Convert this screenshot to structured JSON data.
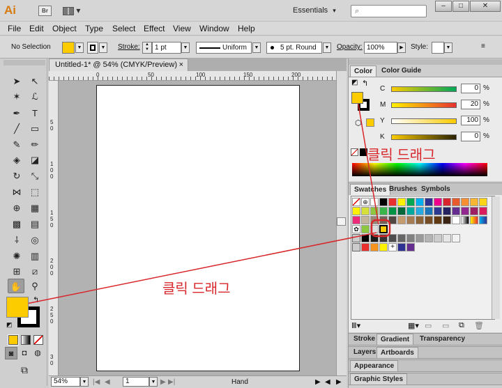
{
  "app": {
    "logo": "Ai",
    "bridge": "Br",
    "layout_arrow": "▾",
    "workspace": "Essentials",
    "workspace_arrow": "▾"
  },
  "window_controls": {
    "minimize": "–",
    "maximize": "□",
    "close": "✕"
  },
  "menu": [
    "File",
    "Edit",
    "Object",
    "Type",
    "Select",
    "Effect",
    "View",
    "Window",
    "Help"
  ],
  "control_bar": {
    "selection": "No Selection",
    "stroke_label": "Stroke:",
    "stroke_weight": "1 pt",
    "profile": "Uniform",
    "brush": "5 pt. Round",
    "opacity_label": "Opacity:",
    "opacity": "100%",
    "style_label": "Style:",
    "fill_color": "#fccb00"
  },
  "document": {
    "tab_title": "Untitled-1* @ 54% (CMYK/Preview)",
    "close": "×",
    "ruler_h": [
      "0",
      "50",
      "100",
      "150",
      "200"
    ],
    "ruler_v": [
      "5",
      "0",
      "1",
      "0",
      "0",
      "1",
      "5",
      "0",
      "2",
      "0",
      "0",
      "2",
      "5",
      "0",
      "3",
      "0"
    ]
  },
  "status": {
    "zoom": "54%",
    "page": "1",
    "tool": "Hand"
  },
  "panels": {
    "color_tab": "Color",
    "guide_tab": "Color Guide",
    "swatches_tab": "Swatches",
    "brushes_tab": "Brushes",
    "symbols_tab": "Symbols",
    "stroke_tab": "Stroke",
    "gradient_tab": "Gradient",
    "transparency_tab": "Transparency",
    "layers_tab": "Layers",
    "artboards_tab": "Artboards",
    "appearance_tab": "Appearance",
    "graphic_styles_tab": "Graphic Styles",
    "cmyk": {
      "C": "0",
      "M": "20",
      "Y": "100",
      "K": "0"
    },
    "cmyk_labels": {
      "C": "C",
      "M": "M",
      "Y": "Y",
      "K": "K"
    },
    "pct": "%"
  },
  "annotations": {
    "drag_text_1": "클릭 드래그",
    "drag_text_2": "클릭 드래그"
  },
  "colors": {
    "fill": "#fccb00",
    "annotation": "#d8262a"
  }
}
